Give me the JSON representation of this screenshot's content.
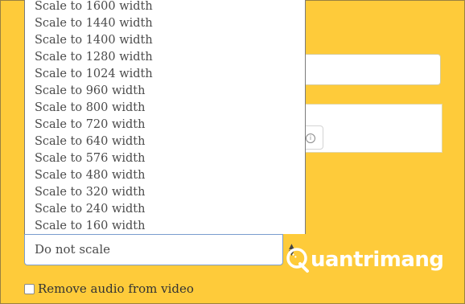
{
  "dropdown": {
    "options": [
      "Scale to 1600 width",
      "Scale to 1440 width",
      "Scale to 1400 width",
      "Scale to 1280 width",
      "Scale to 1024 width",
      "Scale to 960 width",
      "Scale to 800 width",
      "Scale to 720 width",
      "Scale to 640 width",
      "Scale to 576 width",
      "Scale to 480 width",
      "Scale to 320 width",
      "Scale to 240 width",
      "Scale to 160 width"
    ],
    "selected": "Do not scale"
  },
  "remove_audio": {
    "label": "Remove audio from video",
    "checked": false
  },
  "info_button": {
    "glyph": "i"
  },
  "watermark": {
    "text": "uantrimang"
  },
  "colors": {
    "background": "#fecb3a",
    "option_text": "#4a4a4a",
    "select_border": "#7a9ccf"
  }
}
